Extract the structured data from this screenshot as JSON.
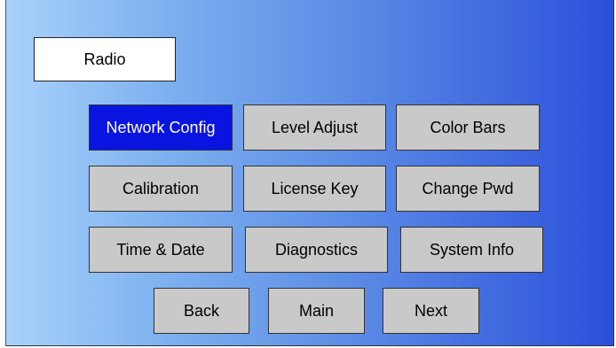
{
  "title": "Radio",
  "menu": {
    "row1": [
      "Network Config",
      "Level Adjust",
      "Color Bars"
    ],
    "row2": [
      "Calibration",
      "License Key",
      "Change Pwd"
    ],
    "row3": [
      "Time & Date",
      "Diagnostics",
      "System Info"
    ]
  },
  "nav": {
    "back": "Back",
    "main": "Main",
    "next": "Next"
  },
  "colors": {
    "active_button": "#0a14e0",
    "button": "#c9c9c9"
  },
  "selected_item": "Network Config"
}
